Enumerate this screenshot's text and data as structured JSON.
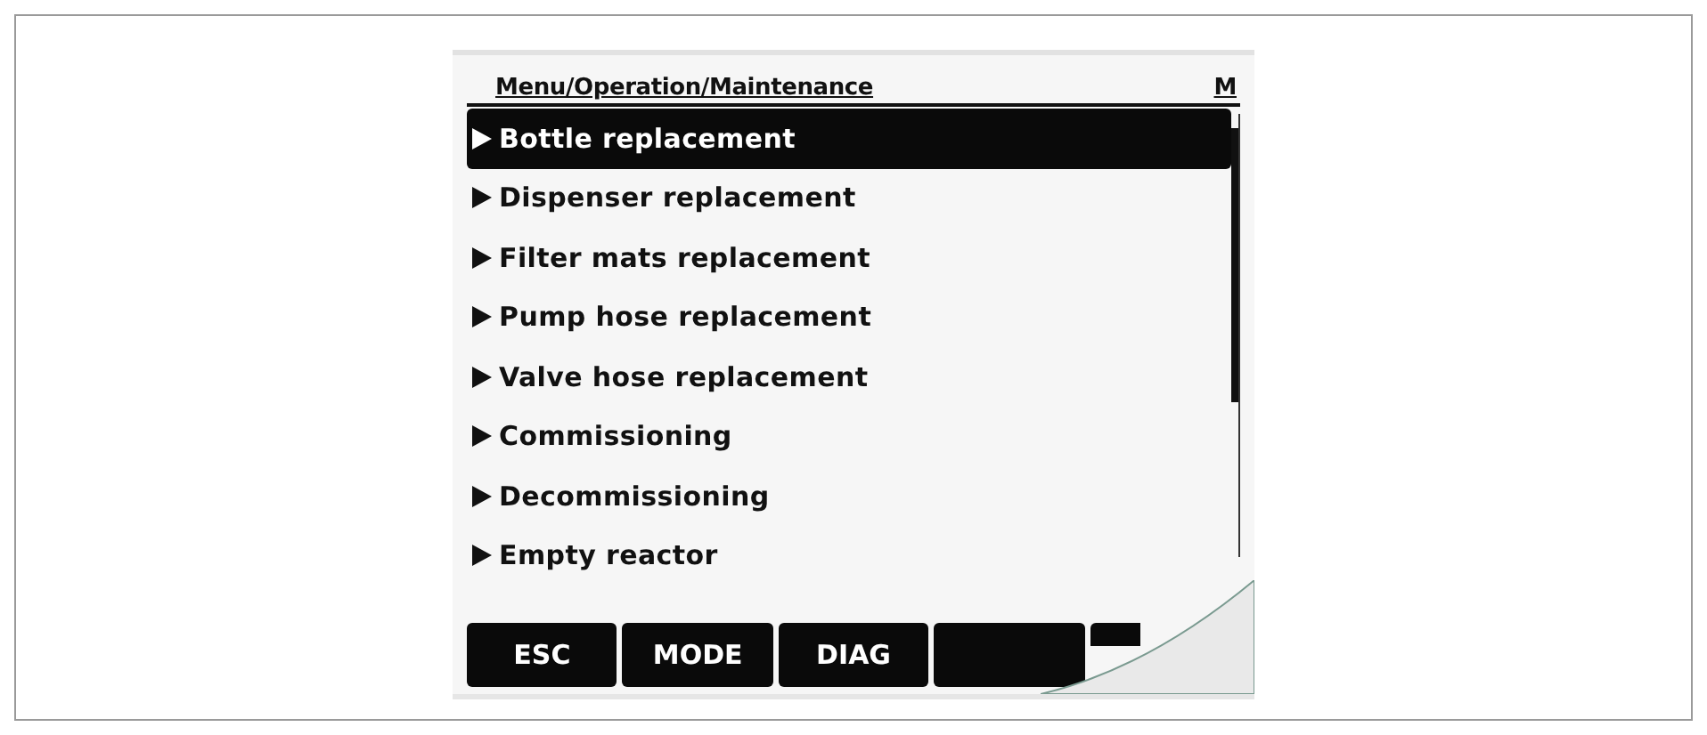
{
  "header": {
    "path": "Menu/Operation/Maintenance",
    "mode": "M"
  },
  "menu_items": [
    {
      "label": "Bottle replacement",
      "selected": true
    },
    {
      "label": "Dispenser replacement",
      "selected": false
    },
    {
      "label": "Filter mats replacement",
      "selected": false
    },
    {
      "label": "Pump hose replacement",
      "selected": false
    },
    {
      "label": "Valve hose replacement",
      "selected": false
    },
    {
      "label": "Commissioning",
      "selected": false
    },
    {
      "label": "Decommissioning",
      "selected": false
    },
    {
      "label": "Empty reactor",
      "selected": false
    }
  ],
  "softkeys": [
    {
      "kind": "labeled",
      "label": "ESC"
    },
    {
      "kind": "labeled",
      "label": "MODE"
    },
    {
      "kind": "labeled",
      "label": "DIAG"
    },
    {
      "kind": "blank"
    },
    {
      "kind": "blank"
    }
  ]
}
